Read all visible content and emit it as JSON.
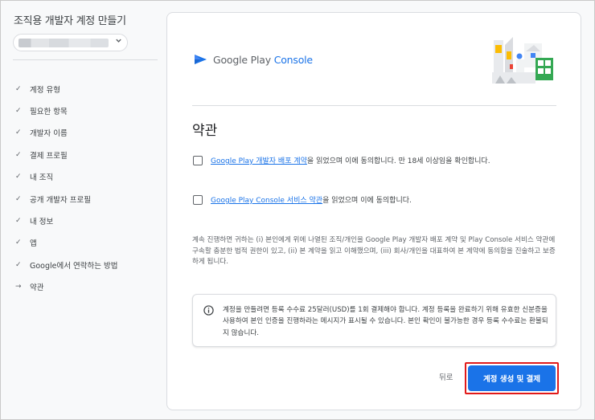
{
  "sidebar": {
    "title": "조직용 개발자 계정 만들기",
    "steps": [
      {
        "label": "계정 유형",
        "icon": "check-icon",
        "mark": "✓"
      },
      {
        "label": "필요한 항목",
        "icon": "check-icon",
        "mark": "✓"
      },
      {
        "label": "개발자 이름",
        "icon": "check-icon",
        "mark": "✓"
      },
      {
        "label": "결제 프로필",
        "icon": "check-icon",
        "mark": "✓"
      },
      {
        "label": "내 조직",
        "icon": "check-icon",
        "mark": "✓"
      },
      {
        "label": "공개 개발자 프로필",
        "icon": "check-icon",
        "mark": "✓"
      },
      {
        "label": "내 정보",
        "icon": "check-icon",
        "mark": "✓"
      },
      {
        "label": "앱",
        "icon": "check-icon",
        "mark": "✓"
      },
      {
        "label": "Google에서 연락하는 방법",
        "icon": "check-icon",
        "mark": "✓"
      },
      {
        "label": "약관",
        "icon": "arrow-right-icon",
        "mark": "→"
      }
    ]
  },
  "logo": {
    "brand": "Google Play",
    "product": "Console"
  },
  "main": {
    "section_title": "약관",
    "agreements": [
      {
        "link": "Google Play 개발자 배포 계약",
        "text": "을 읽었으며 이에 동의합니다. 만 18세 이상임을 확인합니다."
      },
      {
        "link": "Google Play Console 서비스 약관",
        "text": "을 읽었으며 이에 동의합니다."
      }
    ],
    "legal_text": "계속 진행하면 귀하는 (i) 본인에게 위에 나열된 조직/개인을 Google Play 개발자 배포 계약 및 Play Console 서비스 약관에 구속할 충분한 법적 권한이 있고, (ii) 본 계약을 읽고 이해했으며, (iii) 회사/개인을 대표하여 본 계약에 동의함을 진술하고 보증하게 됩니다.",
    "notice": "계정을 만들려면 등록 수수료 25달러(USD)를 1회 결제해야 합니다. 계정 등록을 완료하기 위해 유효한 신분증을 사용하여 본인 인증을 진행하라는 메시지가 표시될 수 있습니다. 본인 확인이 불가능한 경우 등록 수수료는 환불되지 않습니다.",
    "back_label": "뒤로",
    "submit_label": "계정 생성 및 결제"
  },
  "colors": {
    "accent": "#1a73e8",
    "highlight": "#e11a1a"
  }
}
